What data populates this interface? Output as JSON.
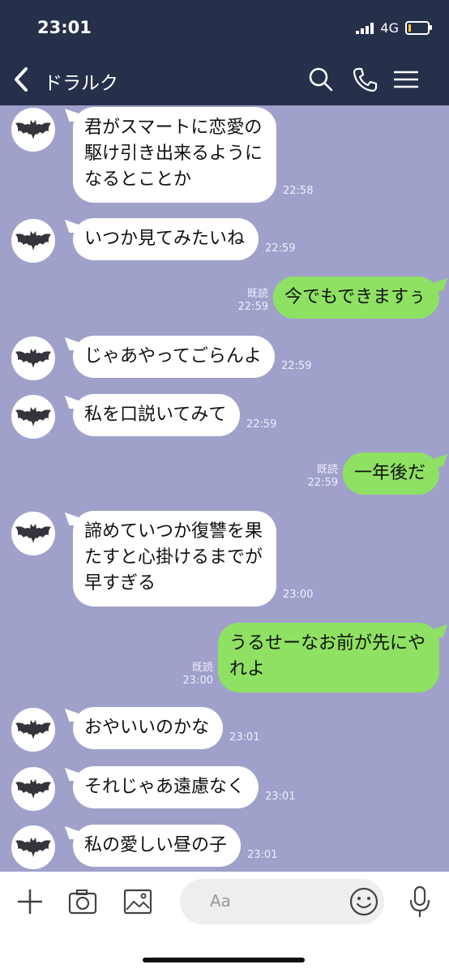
{
  "status_bar": {
    "time": "23:01",
    "network": "4G"
  },
  "header": {
    "title": "ドラルク",
    "back_icon": "back-chevron-icon",
    "search_icon": "search-icon",
    "call_icon": "phone-icon",
    "menu_icon": "menu-icon"
  },
  "messages": [
    {
      "from": "them",
      "lines": [
        "君がスマートに恋愛の",
        "駆け引き出来るように",
        "なるとことか"
      ],
      "time": "22:58"
    },
    {
      "from": "them",
      "lines": [
        "いつか見てみたいね"
      ],
      "time": "22:59"
    },
    {
      "from": "me",
      "lines": [
        "今でもできますぅ"
      ],
      "time": "22:59",
      "read": "既読"
    },
    {
      "from": "them",
      "lines": [
        "じゃあやってごらんよ"
      ],
      "time": "22:59"
    },
    {
      "from": "them",
      "lines": [
        "私を口説いてみて"
      ],
      "time": "22:59"
    },
    {
      "from": "me",
      "lines": [
        "一年後だ"
      ],
      "time": "22:59",
      "read": "既読"
    },
    {
      "from": "them",
      "lines": [
        "諦めていつか復讐を果",
        "たすと心掛けるまでが",
        "早すぎる"
      ],
      "time": "23:00"
    },
    {
      "from": "me",
      "lines": [
        "うるせーなお前が先にや",
        "れよ"
      ],
      "time": "23:00",
      "read": "既読"
    },
    {
      "from": "them",
      "lines": [
        "おやいいのかな"
      ],
      "time": "23:01"
    },
    {
      "from": "them",
      "lines": [
        "それじゃあ遠慮なく"
      ],
      "time": "23:01"
    },
    {
      "from": "them",
      "lines": [
        "私の愛しい昼の子"
      ],
      "time": "23:01"
    }
  ],
  "input_bar": {
    "placeholder": "Aa",
    "icons": [
      "plus-icon",
      "camera-icon",
      "image-icon",
      "emoji-icon",
      "microphone-icon"
    ]
  },
  "colors": {
    "header": "#26304a",
    "chat_background": "#9fa1ca",
    "outgoing_bubble": "#8fe163",
    "incoming_bubble": "#ffffff"
  }
}
